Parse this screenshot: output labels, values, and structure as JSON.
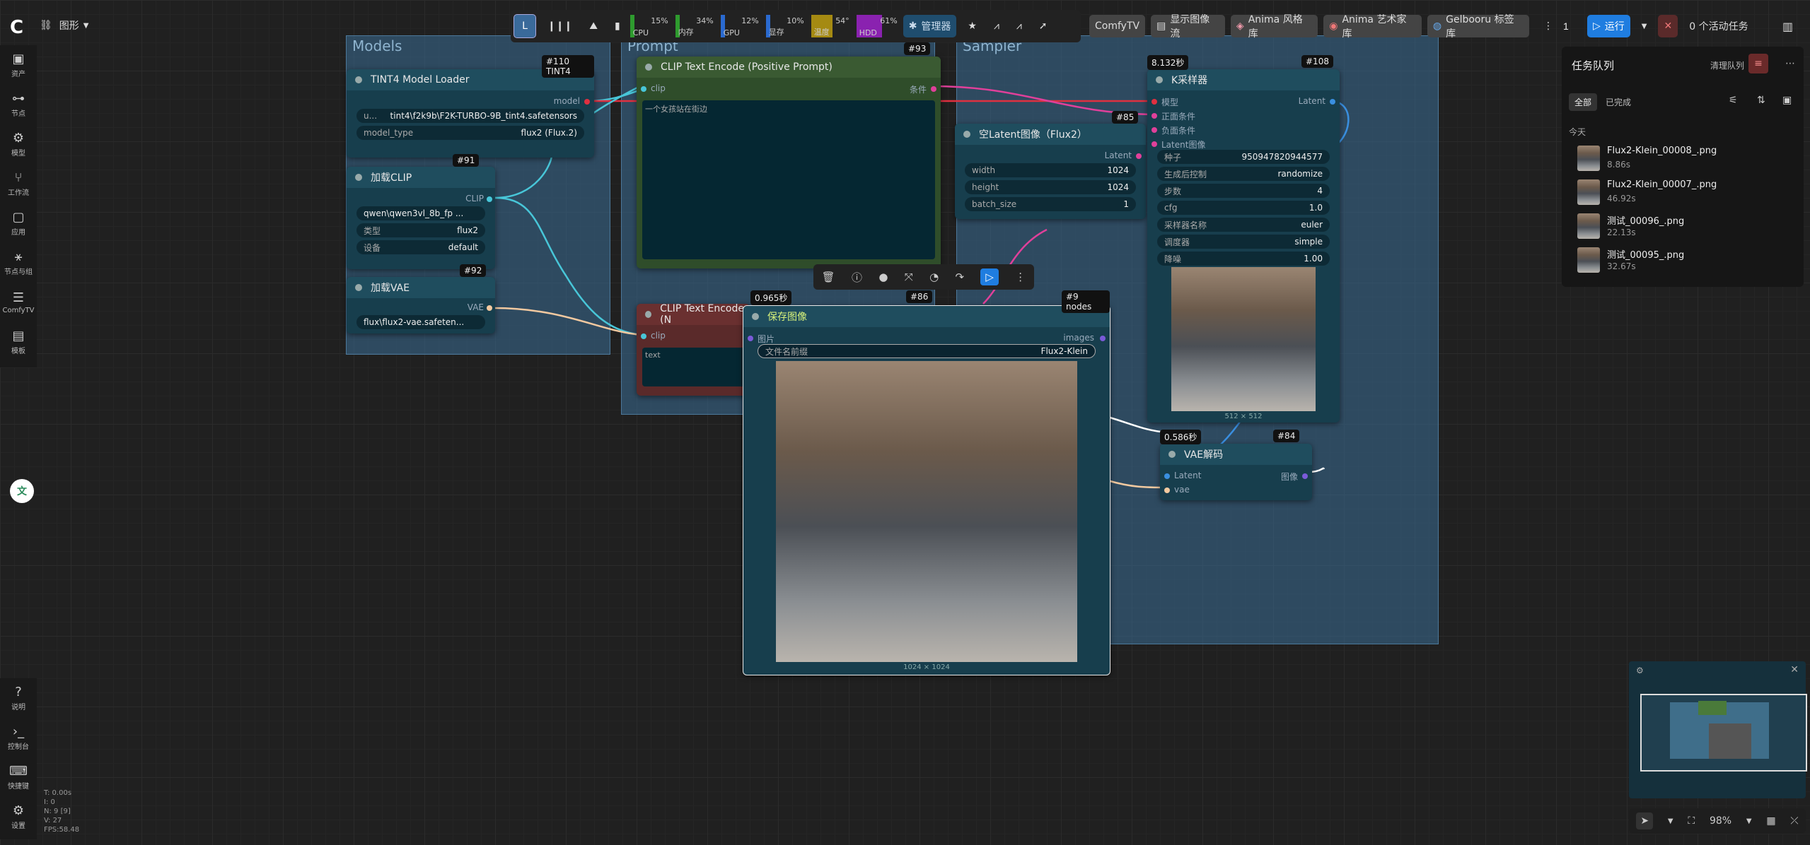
{
  "topbar": {
    "workflow_label": "图形",
    "meters": [
      {
        "name": "CPU",
        "value": "15%",
        "color": "#2e9b2e"
      },
      {
        "name": "内存",
        "value": "34%",
        "color": "#2e9b2e"
      },
      {
        "name": "GPU",
        "value": "12%",
        "color": "#2a6ad0"
      },
      {
        "name": "显存",
        "value": "10%",
        "color": "#2a6ad0"
      },
      {
        "name": "温度",
        "value": "54°",
        "color": "#a58a12"
      },
      {
        "name": "HDD",
        "value": "61%",
        "color": "#8a22b0"
      }
    ],
    "manager_label": "管理器",
    "comfytv_label": "ComfyTV",
    "show_flow_label": "显示图像流",
    "anima_style_label": "Anima 风格库",
    "anima_artist_label": "Anima 艺术家库",
    "gelbooru_label": "Gelbooru 标签库",
    "batch_count": "1",
    "run_label": "运行",
    "active_tasks": "0 个活动任务"
  },
  "sidebar": {
    "items": [
      {
        "label": "资产",
        "icon": "image-icon"
      },
      {
        "label": "节点",
        "icon": "node-icon"
      },
      {
        "label": "模型",
        "icon": "model-icon"
      },
      {
        "label": "工作流",
        "icon": "workflow-icon"
      },
      {
        "label": "应用",
        "icon": "app-icon"
      },
      {
        "label": "节点与组",
        "icon": "tree-icon"
      },
      {
        "label": "ComfyTV",
        "icon": "sliders-icon"
      },
      {
        "label": "模板",
        "icon": "template-icon"
      }
    ],
    "bottom": [
      {
        "label": "说明",
        "icon": "help-icon"
      },
      {
        "label": "控制台",
        "icon": "terminal-icon"
      },
      {
        "label": "快捷键",
        "icon": "keyboard-icon"
      },
      {
        "label": "设置",
        "icon": "gear-icon"
      }
    ]
  },
  "stats": [
    "T: 0.00s",
    "I: 0",
    "N: 9 [9]",
    "V: 27",
    "FPS:58.48"
  ],
  "groups": {
    "models": "Models",
    "prompt": "Prompt",
    "sampler": "Sampler"
  },
  "nodes": {
    "tint4": {
      "title": "TINT4 Model Loader",
      "badge": "#110 TINT4",
      "out": "model",
      "w1_label": "u...",
      "w1_value": "tint4\\f2k9b\\F2K-TURBO-9B_tint4.safetensors",
      "w2_label": "model_type",
      "w2_value": "flux2 (Flux.2)"
    },
    "clip_loader": {
      "title": "加载CLIP",
      "badge": "#91",
      "out": "CLIP",
      "w1_value": "qwen\\qwen3vl_8b_fp ...",
      "w2_label": "类型",
      "w2_value": "flux2",
      "w3_label": "设备",
      "w3_value": "default"
    },
    "vae_loader": {
      "title": "加载VAE",
      "badge": "#92",
      "out": "VAE",
      "w1_value": "flux\\flux2-vae.safeten..."
    },
    "clip_pos": {
      "title": "CLIP Text Encode (Positive Prompt)",
      "badge": "#93",
      "in": "clip",
      "out": "条件",
      "text": "一个女孩站在街边"
    },
    "clip_neg": {
      "title": "CLIP Text Encode (N",
      "in": "clip",
      "text": "text"
    },
    "latent": {
      "title": "空Latent图像（Flux2）",
      "badge": "#85",
      "out": "Latent",
      "w1_label": "width",
      "w1_value": "1024",
      "w2_label": "height",
      "w2_value": "1024",
      "w3_label": "batch_size",
      "w3_value": "1"
    },
    "ksampler": {
      "title": "K采样器",
      "badge": "#108",
      "time": "8.132秒",
      "ins": [
        "模型",
        "正面条件",
        "负面条件",
        "Latent图像"
      ],
      "out": "Latent",
      "widgets": [
        {
          "label": "种子",
          "value": "950947820944577"
        },
        {
          "label": "生成后控制",
          "value": "randomize"
        },
        {
          "label": "步数",
          "value": "4"
        },
        {
          "label": "cfg",
          "value": "1.0"
        },
        {
          "label": "采样器名称",
          "value": "euler"
        },
        {
          "label": "调度器",
          "value": "simple"
        },
        {
          "label": "降噪",
          "value": "1.00"
        }
      ],
      "preview_size": "512 × 512"
    },
    "vae_decode": {
      "title": "VAE解码",
      "badge": "#84",
      "time": "0.586秒",
      "in1": "Latent",
      "in2": "vae",
      "out": "图像"
    },
    "save": {
      "title": "保存图像",
      "badge": "#86",
      "time": "0.965秒",
      "in": "图片",
      "out": "images",
      "w_label": "文件名前缀",
      "w_value": "Flux2-Klein",
      "size": "1024 × 1024"
    }
  },
  "selection_badge": "#9 nodes",
  "queue": {
    "title": "任务队列",
    "clear_label": "清理队列",
    "tab_all": "全部",
    "tab_done": "已完成",
    "section": "今天",
    "items": [
      {
        "name": "Flux2-Klein_00008_.png",
        "time": "8.86s"
      },
      {
        "name": "Flux2-Klein_00007_.png",
        "time": "46.92s"
      },
      {
        "name": "测试_00096_.png",
        "time": "22.13s"
      },
      {
        "name": "测试_00095_.png",
        "time": "32.67s"
      }
    ]
  },
  "zoom": "98%"
}
